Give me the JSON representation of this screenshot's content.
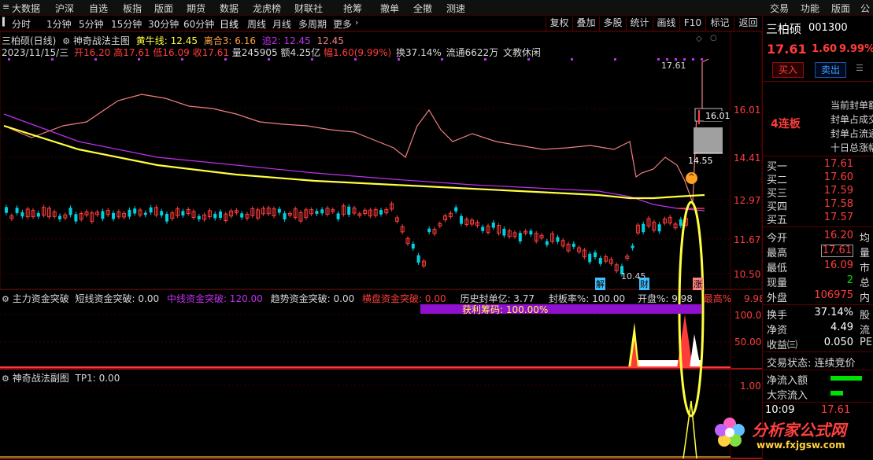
{
  "menubar": {
    "left": [
      "大数据",
      "沪深",
      "自选",
      "板指",
      "版面",
      "期货",
      "数据",
      "龙虎榜",
      "财联社",
      "抢筹",
      "撤单",
      "全撤",
      "测速"
    ],
    "right": [
      "交易",
      "功能",
      "版面",
      "公式"
    ]
  },
  "periods": [
    "分时",
    "1分钟",
    "5分钟",
    "15分钟",
    "30分钟",
    "60分钟",
    "日线",
    "周线",
    "月线",
    "多周期",
    "更多"
  ],
  "active_period": "日线",
  "chart_tools": [
    "复权",
    "叠加",
    "多股",
    "统计",
    "画线",
    "F10",
    "标记",
    "返回"
  ],
  "main_header": {
    "stock_title": "三柏硕(日线)",
    "indicator_name": "神奇战法主图",
    "line1_label": "黄牛线: 12.45",
    "line2_label": "离合3: 6.16",
    "line3_label": "追2: 12.45",
    "line4_label": "12.45",
    "date": "2023/11/15/三",
    "open": "开16.20",
    "high": "高17.61",
    "low": "低16.09",
    "close": "收17.61",
    "volume": "量245905",
    "amount": "额4.25亿",
    "change": "幅1.60(9.99%)",
    "turnover": "换37.14%",
    "float": "流通6622万",
    "sector": "文教休闲"
  },
  "price_axis": [
    "16.01",
    "14.41",
    "12.97",
    "11.67",
    "10.50"
  ],
  "annotations": {
    "peak": "17.61",
    "last": "16.01",
    "gap_low": "14.55",
    "bottom": "10.45",
    "tag_jie": "解",
    "tag_cai": "财",
    "tag_zhang": "涨"
  },
  "sub1_header": {
    "name": "主力资金突破",
    "short_label": "短线资金突破: 0.00",
    "mid_label": "中线资金突破: 120.00",
    "trend_label": "趋势资金突破: 0.00",
    "cross_label": "横盘资金突破: 0.00",
    "hist_label": "历史封单亿: 3.77",
    "seal_label": "封板率%: 100.00",
    "open_label": "开盘%: 9.98",
    "max_label": "最高%",
    "max_value": "9.98",
    "profit_label": "获利筹码:  100.00%"
  },
  "sub1_axis": [
    "100.0",
    "50.00"
  ],
  "sub2_header": {
    "name": "神奇战法副图",
    "tp_label": "TP1: 0.00"
  },
  "sub2_axis": [
    "1.00"
  ],
  "quote": {
    "name": "三柏硕",
    "code": "001300",
    "price": "17.61",
    "change": "1.60",
    "pct": "9.99%",
    "buy_btn": "买入",
    "sell_btn": "卖出",
    "limit_tag": "4连板",
    "notes": [
      "当前封单额",
      "封单占成交",
      "封单占流通",
      "十日总涨幅"
    ],
    "buy_levels": [
      {
        "label": "买一",
        "price": "17.61"
      },
      {
        "label": "买二",
        "price": "17.60"
      },
      {
        "label": "买三",
        "price": "17.59"
      },
      {
        "label": "买四",
        "price": "17.58"
      },
      {
        "label": "买五",
        "price": "17.57"
      }
    ],
    "stats": [
      {
        "label": "今开",
        "value": "16.20",
        "cut": "均"
      },
      {
        "label": "最高",
        "value": "17.61",
        "cut": "量"
      },
      {
        "label": "最低",
        "value": "16.09",
        "cut": "市"
      },
      {
        "label": "现量",
        "value": "2",
        "cut": "总"
      },
      {
        "label": "外盘",
        "value": "106975",
        "cut": "内"
      }
    ],
    "stats2": [
      {
        "label": "换手",
        "value": "37.14%",
        "cut": "股"
      },
      {
        "label": "净资",
        "value": "4.49",
        "cut": "流"
      },
      {
        "label": "收益㈢",
        "value": "0.050",
        "cut": "PE"
      }
    ],
    "trade_state": "交易状态: 连续竞价",
    "net_inflow": "净流入额",
    "big_inflow": "大宗流入",
    "time": "10:09",
    "time_price": "17.61"
  },
  "watermark": {
    "title": "分析家公式网",
    "url": "www.fxjgsw.com"
  },
  "colors": {
    "up": "#ff3c3c",
    "down": "#00d0e0",
    "yellow": "#ffff40",
    "purple": "#c030f0",
    "salmon": "#f08080",
    "grid": "#5a0000"
  }
}
